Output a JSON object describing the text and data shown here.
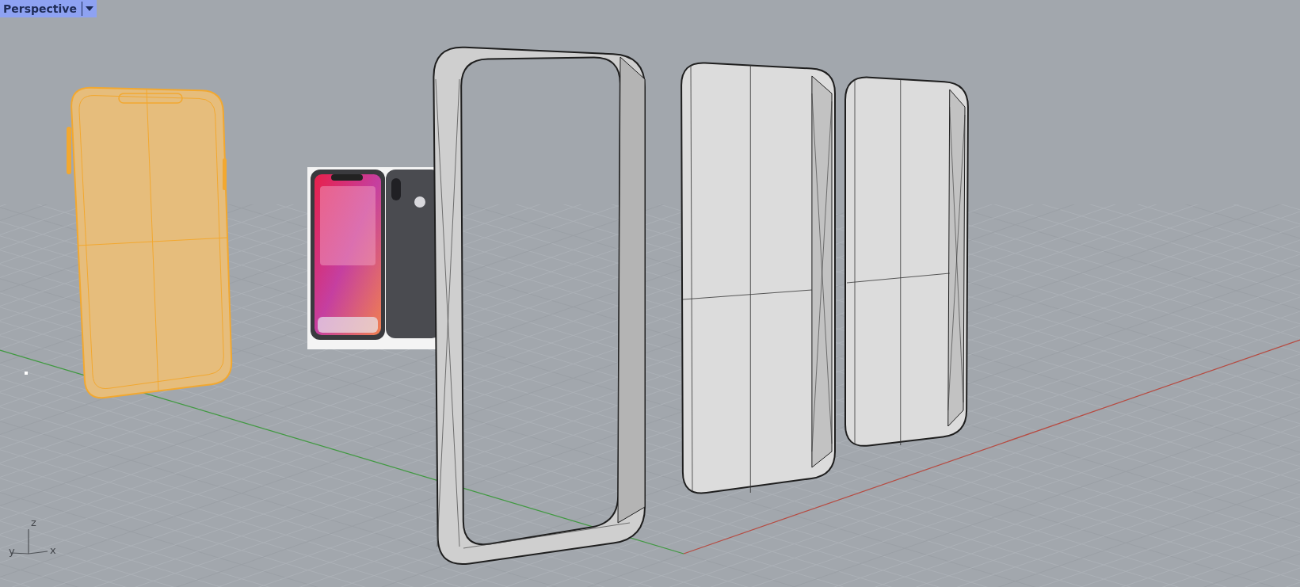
{
  "viewport": {
    "title": "Perspective"
  },
  "scene": {
    "objects": [
      {
        "kind": "phone",
        "selected": true
      },
      {
        "kind": "picture"
      },
      {
        "kind": "frame",
        "selected": false
      },
      {
        "kind": "solid",
        "selected": false
      },
      {
        "kind": "solid",
        "selected": false
      }
    ]
  },
  "axis_widget": {
    "labels": [
      "z",
      "y",
      "x"
    ]
  }
}
